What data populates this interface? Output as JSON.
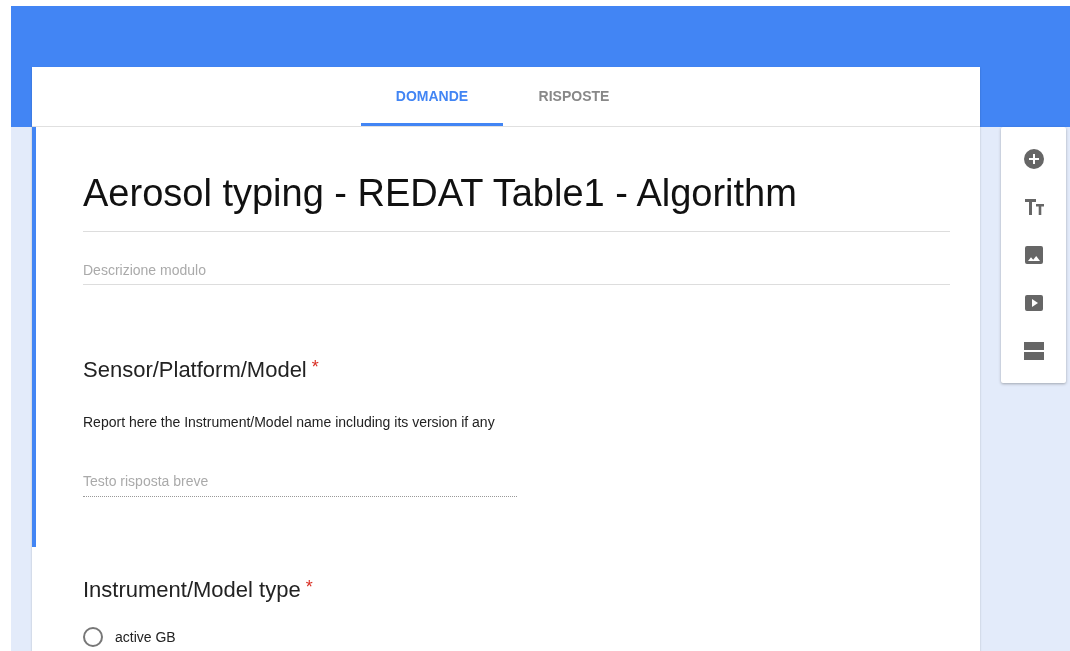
{
  "tabs": [
    {
      "label": "DOMANDE",
      "selected": true
    },
    {
      "label": "RISPOSTE",
      "selected": false
    }
  ],
  "sections": [
    {
      "active": true,
      "form_title": "Aerosol typing - REDAT Table1 - Algorithm",
      "description_placeholder": "Descrizione modulo",
      "questions": [
        {
          "kind": "short_answer",
          "title": "Sensor/Platform/Model",
          "required_mark": "*",
          "help_text": "Report here the Instrument/Model name including its version if any",
          "placeholder": "Testo risposta breve"
        }
      ]
    },
    {
      "active": false,
      "questions": [
        {
          "kind": "multiple_choice",
          "title": "Instrument/Model type",
          "required_mark": "*",
          "options": [
            {
              "label": "active GB",
              "selected": false
            }
          ]
        }
      ]
    }
  ]
}
